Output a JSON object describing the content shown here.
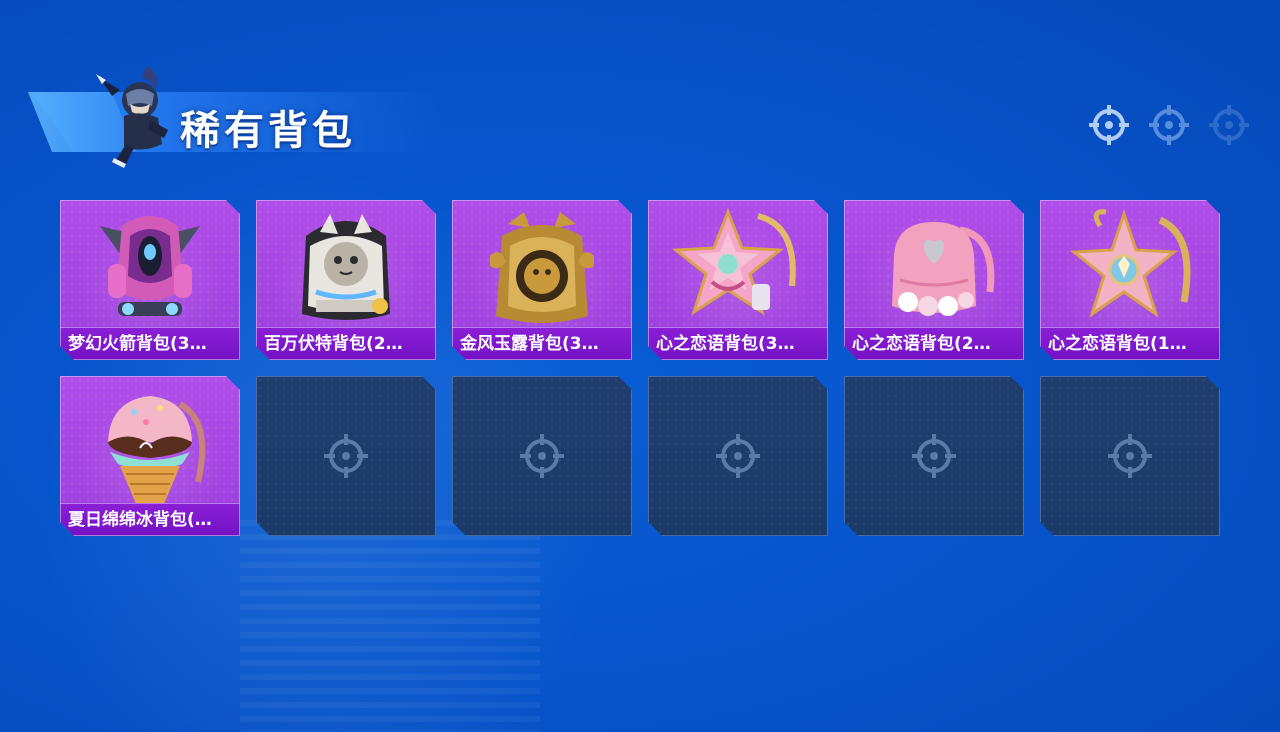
{
  "page": {
    "title": "稀有背包"
  },
  "indicators": [
    {
      "name": "crosshair-indicator-1",
      "icon": "crosshair-icon",
      "opacity": 0.85
    },
    {
      "name": "crosshair-indicator-2",
      "icon": "crosshair-icon",
      "opacity": 0.6
    },
    {
      "name": "crosshair-indicator-3",
      "icon": "crosshair-icon",
      "opacity": 0.25
    }
  ],
  "colors": {
    "background": "#0754cc",
    "card_purple": "#a545e2",
    "label_purple": "#7a16c8",
    "empty_slot": "#1f3e6e"
  },
  "backpacks": [
    {
      "label": "梦幻火箭背包(3…",
      "icon": "rocket-backpack-icon"
    },
    {
      "label": "百万伏特背包(2…",
      "icon": "cat-backpack-icon"
    },
    {
      "label": "金风玉露背包(3…",
      "icon": "golden-backpack-icon"
    },
    {
      "label": "心之恋语背包(3…",
      "icon": "star-backpack-icon"
    },
    {
      "label": "心之恋语背包(2…",
      "icon": "heart-backpack-icon"
    },
    {
      "label": "心之恋语背包(1…",
      "icon": "star-backpack-icon"
    },
    {
      "label": "夏日绵绵冰背包(…",
      "icon": "icecream-backpack-icon"
    }
  ],
  "empty_slots": 5
}
